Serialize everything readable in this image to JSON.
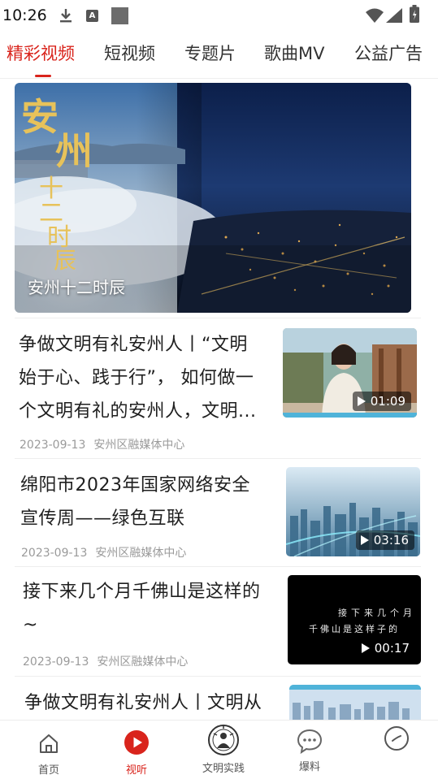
{
  "status_bar": {
    "time": "10:26",
    "icons": [
      "download-icon",
      "a-notification-icon",
      "square-notification-icon",
      "wifi-icon",
      "signal-icon",
      "battery-icon"
    ]
  },
  "tabs": [
    {
      "label": "精彩视频",
      "active": true
    },
    {
      "label": "短视频",
      "active": false
    },
    {
      "label": "专题片",
      "active": false
    },
    {
      "label": "歌曲MV",
      "active": false
    },
    {
      "label": "公益广告",
      "active": false
    }
  ],
  "hero": {
    "caption": "安州十二时辰",
    "art_title": "安州",
    "art_subtitle": "十二时辰"
  },
  "items": [
    {
      "title_lines": [
        "争做文明有礼安州人丨“文明",
        "始于心、践于行”， 如何做一",
        "个文明有礼的安州人，文明..."
      ],
      "date": "2023-09-13",
      "source": "安州区融媒体中心",
      "duration": "01:09"
    },
    {
      "title_lines": [
        "绵阳市2023年国家网络安全",
        "宣传周——绿色互联"
      ],
      "date": "2023-09-13",
      "source": "安州区融媒体中心",
      "duration": "03:16"
    },
    {
      "title_lines": [
        "接下来几个月千佛山是这样的",
        "~"
      ],
      "date": "2023-09-13",
      "source": "安州区融媒体中心",
      "duration": "00:17",
      "thumb_text_lines": [
        "接下来几个月",
        "千佛山是这样子的"
      ]
    },
    {
      "title_lines": [
        "争做文明有礼安州人丨文明从"
      ]
    }
  ],
  "bottom_nav": [
    {
      "label": "首页",
      "icon": "home-icon",
      "active": false
    },
    {
      "label": "视听",
      "icon": "play-circle-icon",
      "active": true
    },
    {
      "label": "文明实践",
      "icon": "civilization-emblem-icon",
      "active": false
    },
    {
      "label": "爆料",
      "icon": "chat-bubble-icon",
      "active": false
    },
    {
      "label": "",
      "icon": "profile-circle-icon",
      "active": false
    }
  ],
  "colors": {
    "accent": "#d9241c",
    "text_primary": "#1f1f1f",
    "text_meta": "#9a9a9a"
  }
}
